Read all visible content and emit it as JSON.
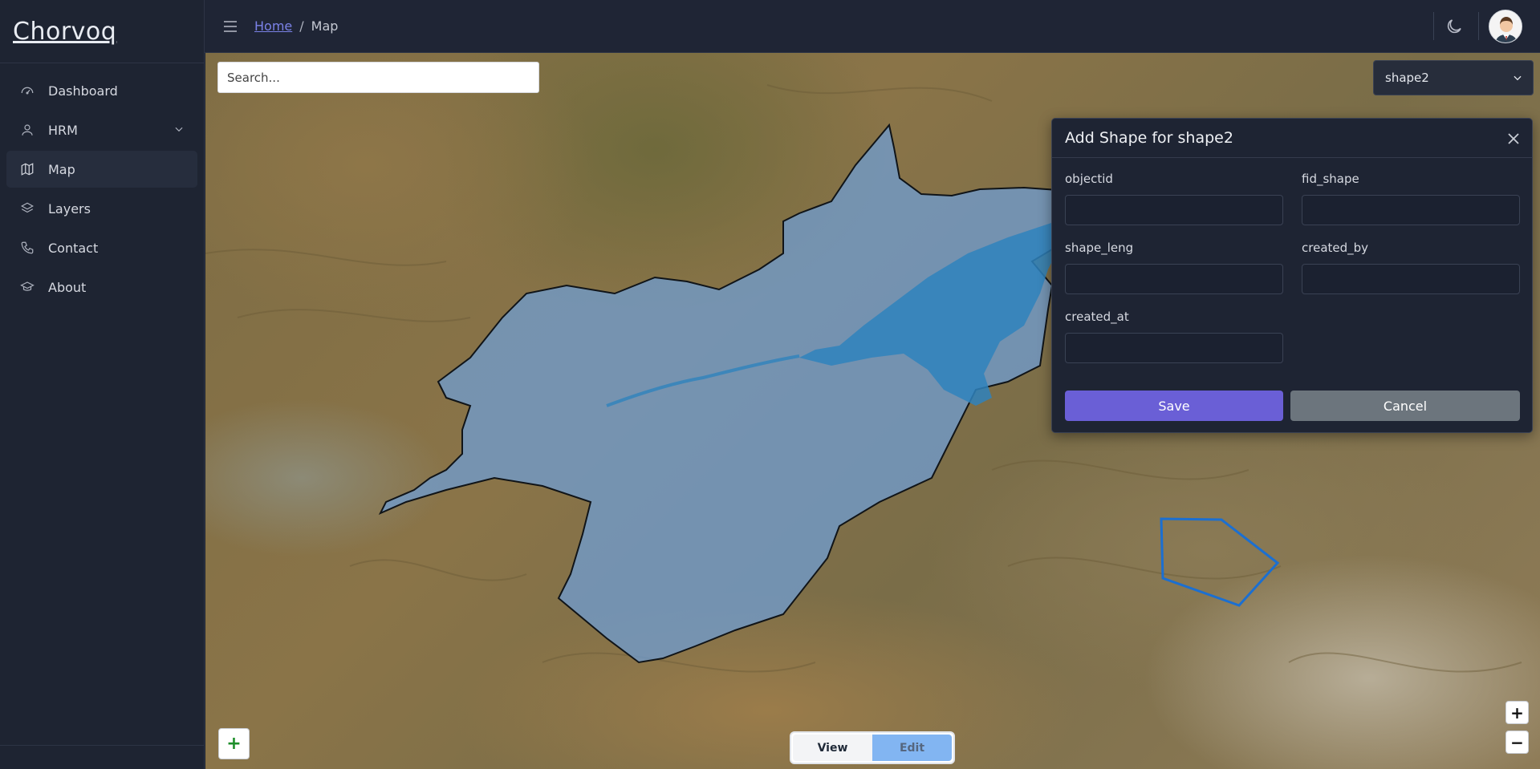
{
  "app": {
    "brand": "Chorvoq"
  },
  "sidebar": {
    "items": [
      {
        "label": "Dashboard",
        "icon": "dashboard-icon"
      },
      {
        "label": "HRM",
        "icon": "user-icon",
        "expandable": true
      },
      {
        "label": "Map",
        "icon": "map-icon",
        "active": true
      },
      {
        "label": "Layers",
        "icon": "layers-icon"
      },
      {
        "label": "Contact",
        "icon": "phone-icon"
      },
      {
        "label": "About",
        "icon": "graduation-cap-icon"
      }
    ]
  },
  "header": {
    "breadcrumb": {
      "home": "Home",
      "separator": "/",
      "current": "Map"
    },
    "theme_icon": "moon-icon",
    "avatar_icon": "user-avatar"
  },
  "map": {
    "search_placeholder": "Search...",
    "layer_select": {
      "value": "shape2"
    },
    "view_toggle": {
      "view": "View",
      "edit": "Edit",
      "active": "edit"
    },
    "add_button": "+",
    "zoom_in": "+",
    "zoom_out": "−",
    "polygon_fill": "#6f9fd8",
    "polygon_outline": "#1b6fd1"
  },
  "modal": {
    "title": "Add Shape for shape2",
    "fields": [
      {
        "label": "objectid",
        "value": ""
      },
      {
        "label": "fid_shape",
        "value": ""
      },
      {
        "label": "shape_leng",
        "value": ""
      },
      {
        "label": "created_by",
        "value": ""
      },
      {
        "label": "created_at",
        "value": ""
      }
    ],
    "save_label": "Save",
    "cancel_label": "Cancel"
  },
  "colors": {
    "accent": "#6a5fd6",
    "sidebar_bg": "#1e2432",
    "cancel": "#6c757d",
    "link": "#7b82e8"
  }
}
